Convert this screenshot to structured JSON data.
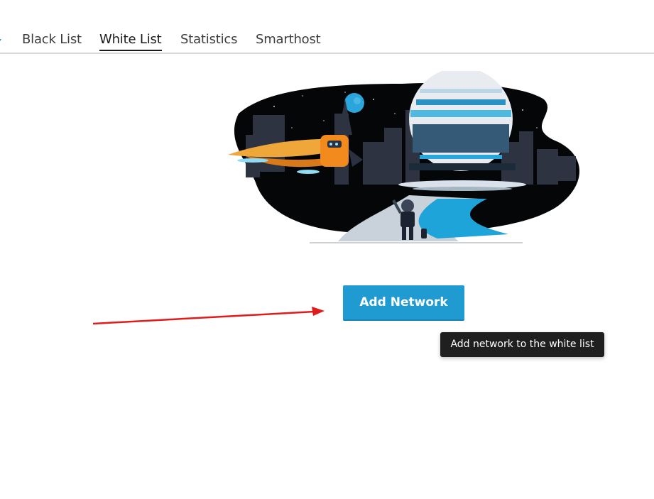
{
  "tabs": [
    {
      "label": "Black List",
      "active": false
    },
    {
      "label": "White List",
      "active": true
    },
    {
      "label": "Statistics",
      "active": false
    },
    {
      "label": "Smarthost",
      "active": false
    }
  ],
  "main": {
    "add_button_label": "Add Network",
    "tooltip_text": "Add network to the white list"
  },
  "colors": {
    "accent": "#1f9bd1",
    "tooltip_bg": "#1f1f1f",
    "annotation_arrow": "#e01b1b",
    "tab_divider": "#d9d9d9"
  },
  "icons": {
    "illustration": "space-city-astronaut-illustration",
    "annotation": "red-arrow-annotation"
  }
}
